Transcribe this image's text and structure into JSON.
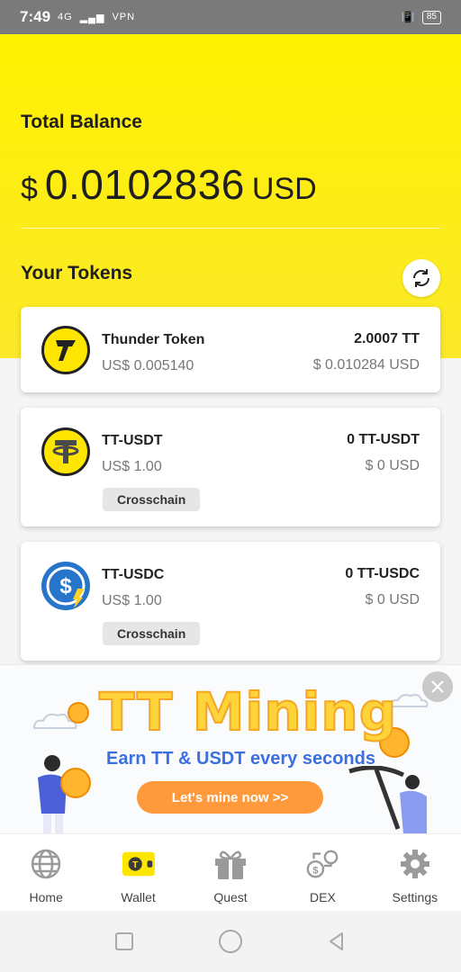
{
  "status_bar": {
    "time": "7:49",
    "signal": "4G",
    "network": "VPN",
    "battery": "85"
  },
  "wallet": {
    "total_label": "Total Balance",
    "currency_symbol": "$",
    "total_amount": "0.0102836",
    "total_unit": "USD",
    "tokens_label": "Your Tokens",
    "refresh_icon": "refresh-icon"
  },
  "tokens": [
    {
      "name": "Thunder Token",
      "price": "US$ 0.005140",
      "balance": "2.0007 TT",
      "value": "$ 0.010284 USD",
      "icon": "thunder-token-icon",
      "chip": ""
    },
    {
      "name": "TT-USDT",
      "price": "US$ 1.00",
      "balance": "0 TT-USDT",
      "value": "$ 0 USD",
      "icon": "tether-icon",
      "chip": "Crosschain"
    },
    {
      "name": "TT-USDC",
      "price": "US$ 1.00",
      "balance": "0 TT-USDC",
      "value": "$ 0 USD",
      "icon": "usdc-icon",
      "chip": "Crosschain"
    }
  ],
  "banner": {
    "title": "TT Mining",
    "subtitle": "Earn TT & USDT every seconds",
    "button": "Let's mine now >>"
  },
  "tabbar": {
    "items": [
      {
        "label": "Home",
        "icon": "globe-icon",
        "active": false
      },
      {
        "label": "Wallet",
        "icon": "wallet-icon",
        "active": true
      },
      {
        "label": "Quest",
        "icon": "gift-icon",
        "active": false
      },
      {
        "label": "DEX",
        "icon": "dex-icon",
        "active": false
      },
      {
        "label": "Settings",
        "icon": "gear-icon",
        "active": false
      }
    ]
  },
  "colors": {
    "accent": "#fff200",
    "banner_button": "#ff9a3c",
    "banner_sub": "#3b6fe0"
  }
}
